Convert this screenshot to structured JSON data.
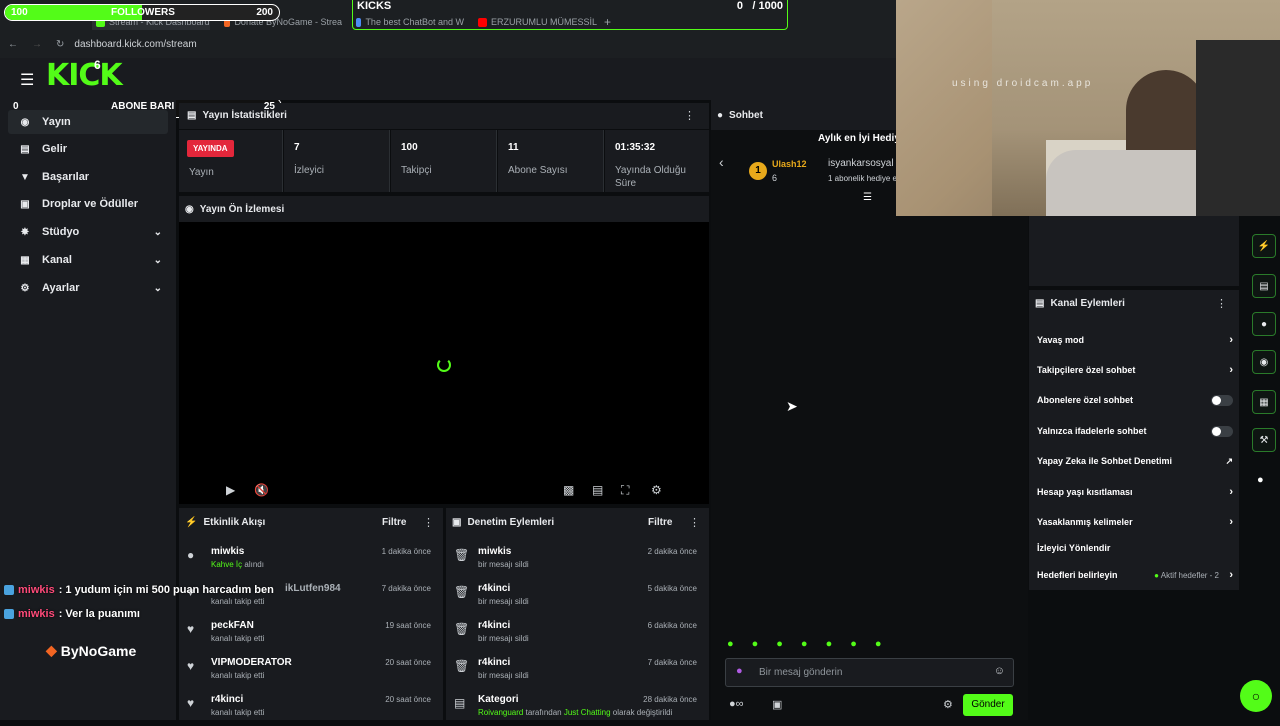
{
  "browser": {
    "tabs": [
      "Stream - Kick Dashboard",
      "Donate ByNoGame - Strea",
      "The best ChatBot and W",
      "ERZURUMLU MÜMESSİL"
    ],
    "url": "dashboard.kick.com/stream"
  },
  "overlay": {
    "followers": {
      "label": "FOLLOWERS",
      "current": "100",
      "goal": "200",
      "progress": 0.5
    },
    "kicks": {
      "label": "KICKS",
      "value": "0",
      "goal": "/ 1000"
    },
    "subs": {
      "label": "ABONE BARI",
      "current": "0",
      "goal": "25",
      "progress": 0.02
    },
    "chat": [
      {
        "user": "miwkis",
        "text": " : 1 yudum için mi 500 puan harcadım ben"
      },
      {
        "user": "miwkis",
        "text": " : Ver la puanımı"
      }
    ],
    "sponsor": "ByNoGame",
    "webcam_watermark": "using droidcam.app"
  },
  "header": {
    "logo": "KICK",
    "badge_count": "6"
  },
  "sidebar": {
    "items": [
      {
        "label": "Yayın",
        "icon": "broadcast-icon",
        "expandable": false
      },
      {
        "label": "Gelir",
        "icon": "wallet-icon",
        "expandable": false
      },
      {
        "label": "Başarılar",
        "icon": "trophy-icon",
        "expandable": false
      },
      {
        "label": "Droplar ve Ödüller",
        "icon": "gift-icon",
        "expandable": false
      },
      {
        "label": "Stüdyo",
        "icon": "studio-icon",
        "expandable": true
      },
      {
        "label": "Kanal",
        "icon": "channel-icon",
        "expandable": true
      },
      {
        "label": "Ayarlar",
        "icon": "gear-icon",
        "expandable": true
      }
    ]
  },
  "stats": {
    "title": "Yayın İstatistikleri",
    "live_badge": "YAYINDA",
    "live_label": "Yayın",
    "items": [
      {
        "value": "7",
        "label": "İzleyici"
      },
      {
        "value": "100",
        "label": "Takipçi"
      },
      {
        "value": "11",
        "label": "Abone Sayısı"
      },
      {
        "value": "01:35:32",
        "label": "Yayında Olduğu Süre"
      }
    ]
  },
  "preview": {
    "title": "Yayın Ön İzlemesi"
  },
  "activity": {
    "title": "Etkinlik Akışı",
    "filter": "Filtre",
    "rows": [
      {
        "name": "miwkis",
        "sub": "Kahve İç",
        "sub2": " alındı",
        "time": "1 dakika önce",
        "icon": "kick-points-icon"
      },
      {
        "name": "",
        "sub": "kanalı takip etti",
        "sub2": "",
        "time": "7 dakika önce",
        "icon": "heart-icon",
        "partial_name": "ikLutfen984"
      },
      {
        "name": "peckFAN",
        "sub": "kanalı takip etti",
        "sub2": "",
        "time": "19 saat önce",
        "icon": "heart-icon"
      },
      {
        "name": "VIPMODERATOR",
        "sub": "kanalı takip etti",
        "sub2": "",
        "time": "20 saat önce",
        "icon": "heart-icon"
      },
      {
        "name": "r4kinci",
        "sub": "kanalı takip etti",
        "sub2": "",
        "time": "20 saat önce",
        "icon": "heart-icon"
      }
    ]
  },
  "moderation": {
    "title": "Denetim Eylemleri",
    "filter": "Filtre",
    "rows": [
      {
        "name": "miwkis",
        "sub": "bir mesajı sildi",
        "time": "2 dakika önce"
      },
      {
        "name": "r4kinci",
        "sub": "bir mesajı sildi",
        "time": "5 dakika önce"
      },
      {
        "name": "r4kinci",
        "sub": "bir mesajı sildi",
        "time": "6 dakika önce"
      },
      {
        "name": "r4kinci",
        "sub": "bir mesajı sildi",
        "time": "7 dakika önce"
      }
    ],
    "last": {
      "name": "Kategori",
      "actor": "Roivanguard",
      "mid": " tarafından ",
      "cat": "Just Chatting",
      "end": " olarak değiştirildi",
      "time": "28 dakika önce"
    }
  },
  "chat": {
    "title": "Sohbet",
    "leaderboard_title": "Aylık en İyi Hediye",
    "top_user": "Ulash12",
    "top_count": "6",
    "second_user": "isyankarsosyal",
    "second_sub": "1 abonelik hediye e",
    "input_placeholder": "Bir mesaj gönderin",
    "send": "Gönder"
  },
  "channel_actions": {
    "title": "Kanal Eylemleri",
    "items": [
      {
        "label": "Yavaş mod",
        "control": "chevron"
      },
      {
        "label": "Takipçilere özel sohbet",
        "control": "chevron"
      },
      {
        "label": "Abonelere özel sohbet",
        "control": "toggle"
      },
      {
        "label": "Yalnızca ifadelerle sohbet",
        "control": "toggle"
      },
      {
        "label": "Yapay Zeka ile Sohbet Denetimi",
        "control": "external"
      },
      {
        "label": "Hesap yaşı kısıtlaması",
        "control": "chevron"
      },
      {
        "label": "Yasaklanmış kelimeler",
        "control": "chevron"
      },
      {
        "label": "İzleyici Yönlendir",
        "control": "none"
      },
      {
        "label": "Hedefleri belirleyin",
        "control": "chevron",
        "extra": "Aktif hedefler - 2"
      }
    ]
  }
}
